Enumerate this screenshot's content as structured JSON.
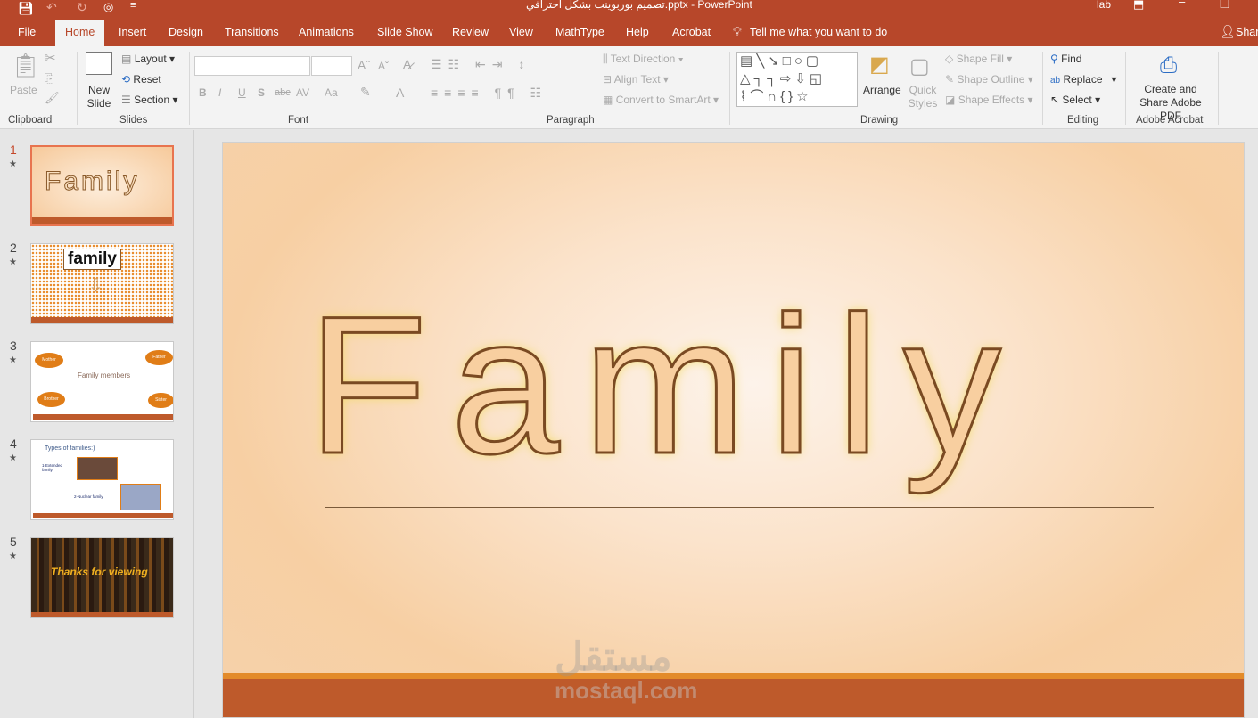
{
  "titlebar": {
    "title": "تصميم بوربوينت بشكل احترافي.pptx  -  PowerPoint",
    "user": "lab"
  },
  "tabs": [
    "File",
    "Home",
    "Insert",
    "Design",
    "Transitions",
    "Animations",
    "Slide Show",
    "Review",
    "View",
    "MathType",
    "Help",
    "Acrobat"
  ],
  "tell_me": "Tell me what you want to do",
  "share": "Share",
  "ribbon": {
    "clipboard": {
      "label": "Clipboard",
      "paste": "Paste"
    },
    "slides": {
      "label": "Slides",
      "new_slide": "New Slide",
      "layout": "Layout",
      "reset": "Reset",
      "section": "Section"
    },
    "font": {
      "label": "Font",
      "bold": "B",
      "italic": "I",
      "underline": "U",
      "shadow": "S",
      "strike": "abc",
      "spacing": "AV",
      "case": "Aa",
      "color": "A"
    },
    "paragraph": {
      "label": "Paragraph",
      "text_direction": "Text Direction",
      "align_text": "Align Text",
      "smartart": "Convert to SmartArt"
    },
    "drawing": {
      "label": "Drawing",
      "arrange": "Arrange",
      "quick_styles": "Quick Styles",
      "shape_fill": "Shape Fill",
      "shape_outline": "Shape Outline",
      "shape_effects": "Shape Effects"
    },
    "editing": {
      "label": "Editing",
      "find": "Find",
      "replace": "Replace",
      "select": "Select"
    },
    "acrobat": {
      "label": "Adobe Acrobat",
      "create": "Create and Share Adobe PDF"
    }
  },
  "thumbnails": [
    {
      "num": "1",
      "text": "Family"
    },
    {
      "num": "2",
      "text": "family"
    },
    {
      "num": "3",
      "text": "Family members",
      "bubbles": [
        "Mother",
        "Father",
        "Brother",
        "Sister"
      ]
    },
    {
      "num": "4",
      "text": "Types of families:)",
      "items": [
        "1-Extended family.",
        "2-Nuclear family."
      ]
    },
    {
      "num": "5",
      "text": "Thanks for viewing"
    }
  ],
  "slide": {
    "title": "Family",
    "watermark_ar": "مستقل",
    "watermark": "mostaql.com"
  },
  "colors": {
    "accent": "#b7472a",
    "slide_bar": "#be5a2b",
    "slide_stripe": "#e38b2a"
  }
}
